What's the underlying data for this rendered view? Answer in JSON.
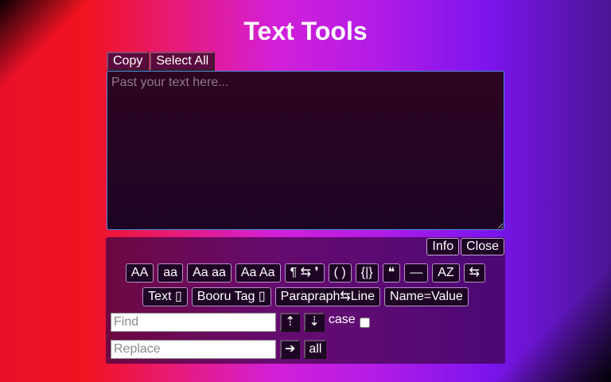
{
  "title": "Text Tools",
  "top_buttons": {
    "copy": "Copy",
    "select_all": "Select All"
  },
  "editor": {
    "placeholder": "Past your text here...",
    "value": ""
  },
  "panel": {
    "info": "Info",
    "close": "Close",
    "row1": [
      "AA",
      "aa",
      "Aa aa",
      "Aa Aa",
      "¶ ⇆ ❜",
      "( )",
      "{|}",
      "❝",
      "⎯⎯",
      "AZ",
      "⇆"
    ],
    "row2": [
      "Text ▯",
      "Booru Tag ▯",
      "Parapraph⇆Line",
      "Name=Value"
    ],
    "find": {
      "placeholder": "Find",
      "up": "⇡",
      "down": "⇣",
      "case_label": "case"
    },
    "replace": {
      "placeholder": "Replace",
      "go": "➔",
      "all": "all"
    }
  },
  "colors": {
    "accent_gradient_start": "#e8102a",
    "accent_gradient_end": "#7c14ee",
    "button_bg": "#1d0424",
    "panel_bg": "#3c0446"
  }
}
